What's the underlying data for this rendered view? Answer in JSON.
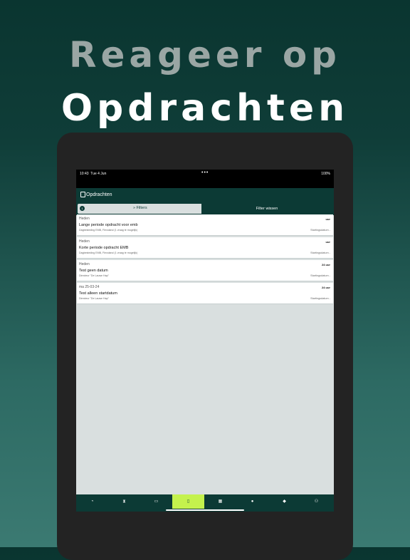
{
  "headline": {
    "line1": "Reageer op",
    "line2": "Opdrachten"
  },
  "status_bar": {
    "time": "10:43",
    "date": "Tue 4 Jun",
    "dots": "•••",
    "battery": "100%"
  },
  "nav": {
    "title": "Opdrachten"
  },
  "filter": {
    "badge": "1",
    "label": "Filters",
    "clear": "Filter wissen"
  },
  "assignments": [
    {
      "date": "Heden",
      "title": "Lange periode opdracht voor emb",
      "subtitle": "Dagbesteding EMB, Flevoland (1 vraag te mogelijk)",
      "hours": "uur",
      "start": "Startingsdatum -"
    },
    {
      "date": "Heden",
      "title": "Korte periode opdracht EMB",
      "subtitle": "Dagbesteding EMB, Flevoland (1 vraag te mogelijk)",
      "hours": "uur",
      "start": "Startingsdatum -"
    },
    {
      "date": "Heden",
      "title": "Test geen datum",
      "subtitle": "Directeur \"De Lauwe Hap\"",
      "hours": "24 uur",
      "start": "Startingsdatum -"
    },
    {
      "date": "ma 25-03-24",
      "title": "Test alleen startdatum",
      "subtitle": "Directeur \"De Lauwe Hap\"",
      "hours": "24 uur",
      "start": "Startingsdatum -"
    }
  ],
  "tabs": [
    {
      "icon": "dashboard-icon",
      "glyph": "◔"
    },
    {
      "icon": "hourglass-icon",
      "glyph": "⧗"
    },
    {
      "icon": "id-card-icon",
      "glyph": "▭"
    },
    {
      "icon": "assignment-icon",
      "glyph": "▯",
      "active": true
    },
    {
      "icon": "calendar-icon",
      "glyph": "▦"
    },
    {
      "icon": "users-icon",
      "glyph": "●"
    },
    {
      "icon": "chat-icon",
      "glyph": "◆"
    },
    {
      "icon": "profile-icon",
      "glyph": "⚇"
    }
  ],
  "colors": {
    "primary": "#0c3a35",
    "accent": "#c4f24d",
    "background": "#d9dfdf"
  }
}
